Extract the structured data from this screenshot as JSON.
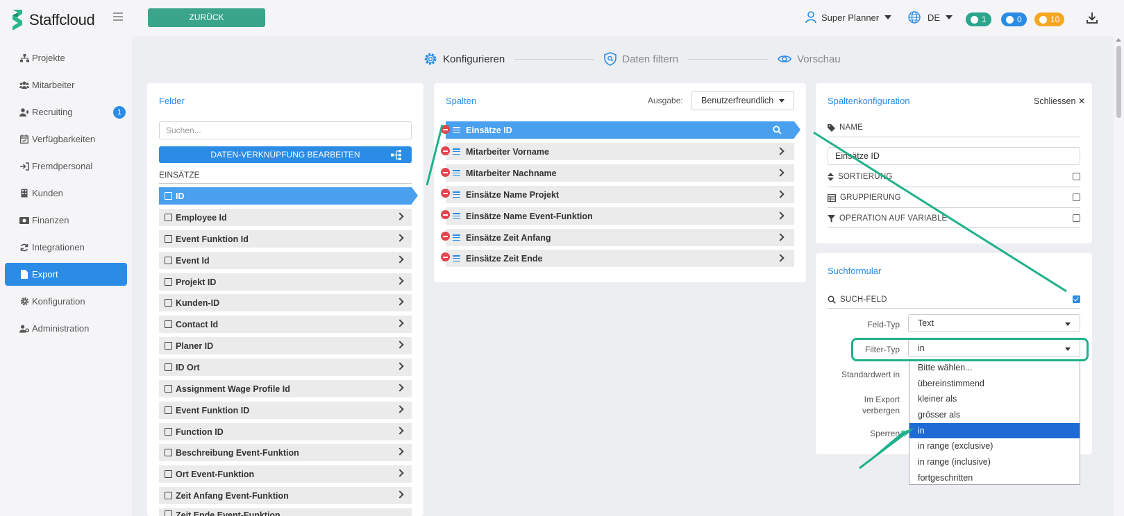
{
  "app": {
    "brand": "Staffcloud",
    "back_button": "ZURÜCK",
    "user_name": "Super Planner",
    "language": "DE",
    "badges": [
      {
        "count": "1",
        "color": "#2ca58d"
      },
      {
        "count": "0",
        "color": "#2b8ce6"
      },
      {
        "count": "10",
        "color": "#f5a623"
      }
    ]
  },
  "sidebar": {
    "items": [
      {
        "label": "Projekte",
        "icon": "sitemap-icon"
      },
      {
        "label": "Mitarbeiter",
        "icon": "users-icon"
      },
      {
        "label": "Recruiting",
        "icon": "user-plus-icon",
        "badge": "1"
      },
      {
        "label": "Verfügbarkeiten",
        "icon": "calendar-check-icon"
      },
      {
        "label": "Fremdpersonal",
        "icon": "sign-in-icon"
      },
      {
        "label": "Kunden",
        "icon": "building-icon"
      },
      {
        "label": "Finanzen",
        "icon": "money-icon"
      },
      {
        "label": "Integrationen",
        "icon": "refresh-icon"
      },
      {
        "label": "Export",
        "icon": "file-icon",
        "active": true
      },
      {
        "label": "Konfiguration",
        "icon": "gear-icon"
      },
      {
        "label": "Administration",
        "icon": "user-cog-icon"
      }
    ]
  },
  "steps": [
    {
      "label": "Konfigurieren",
      "icon": "gear-icon",
      "active": true
    },
    {
      "label": "Daten filtern",
      "icon": "shield-search-icon",
      "active": false
    },
    {
      "label": "Vorschau",
      "icon": "eye-icon",
      "active": false
    }
  ],
  "felder": {
    "title": "Felder",
    "search_placeholder": "Suchen...",
    "link_button": "DATEN-VERKNÜPFUNG BEARBEITEN",
    "section": "EINSÄTZE",
    "fields": [
      {
        "label": "ID",
        "active": true
      },
      {
        "label": "Employee Id"
      },
      {
        "label": "Event Funktion Id"
      },
      {
        "label": "Event Id"
      },
      {
        "label": "Projekt ID"
      },
      {
        "label": "Kunden-ID"
      },
      {
        "label": "Contact Id"
      },
      {
        "label": "Planer ID"
      },
      {
        "label": "ID Ort"
      },
      {
        "label": "Assignment Wage Profile Id"
      },
      {
        "label": "Event Funktion ID"
      },
      {
        "label": "Function ID"
      },
      {
        "label": "Beschreibung Event-Funktion"
      },
      {
        "label": "Ort Event-Funktion"
      },
      {
        "label": "Zeit Anfang Event-Funktion"
      },
      {
        "label": "Zeit Ende Event-Funktion"
      }
    ]
  },
  "spalten": {
    "title": "Spalten",
    "ausgabe_label": "Ausgabe:",
    "ausgabe_value": "Benutzerfreundlich",
    "columns": [
      {
        "label": "Einsätze ID",
        "active": true
      },
      {
        "label": "Mitarbeiter Vorname"
      },
      {
        "label": "Mitarbeiter Nachname"
      },
      {
        "label": "Einsätze Name Projekt"
      },
      {
        "label": "Einsätze Name Event-Funktion"
      },
      {
        "label": "Einsätze Zeit Anfang"
      },
      {
        "label": "Einsätze Zeit Ende"
      }
    ]
  },
  "config": {
    "title": "Spaltenkonfiguration",
    "close_label": "Schliessen ✕",
    "name_label": "NAME",
    "name_value": "Einsätze ID",
    "sort_label": "SORTIERUNG",
    "group_label": "GRUPPIERUNG",
    "operation_label": "OPERATION AUF VARIABLE"
  },
  "suchformular": {
    "title": "Suchformular",
    "such_feld_label": "SUCH-FELD",
    "such_feld_checked": true,
    "feld_typ_label": "Feld-Typ",
    "feld_typ_value": "Text",
    "filter_typ_label": "Filter-Typ",
    "filter_typ_value": "in",
    "standardwert_label": "Standardwert in",
    "im_export_label_1": "Im Export",
    "im_export_label_2": "verbergen",
    "sperren_label": "Sperren",
    "options": [
      "Bitte wählen...",
      "übereinstimmend",
      "kleiner als",
      "grösser als",
      "in",
      "in range (exclusive)",
      "in range (inclusive)",
      "fortgeschritten"
    ],
    "selected_option": "in"
  },
  "colors": {
    "primary": "#2b8ce6",
    "back_green": "#3aa58a",
    "annotation_green": "#1fb18a",
    "remove_red": "#e0464d"
  }
}
